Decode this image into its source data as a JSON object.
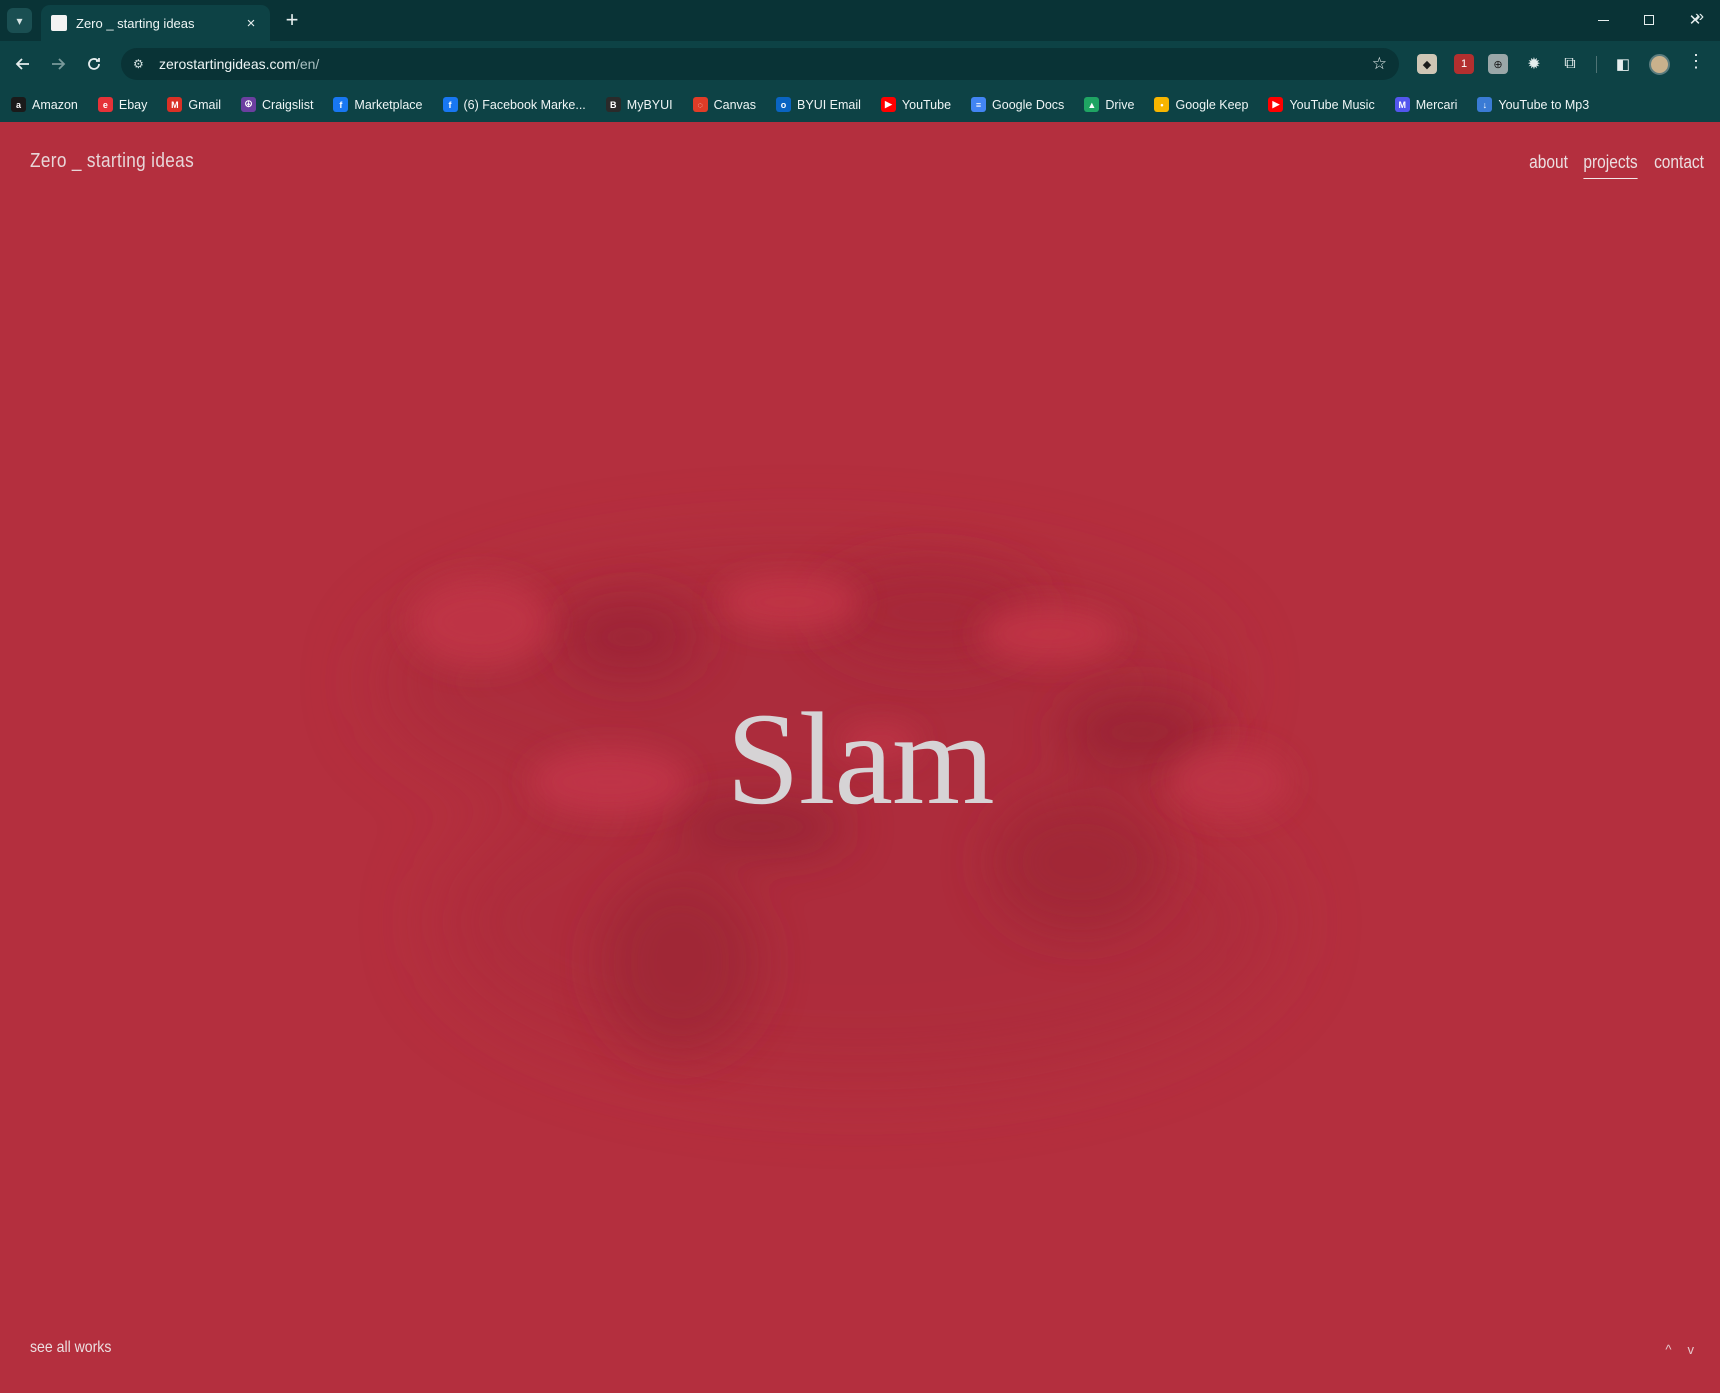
{
  "browser": {
    "tab_title": "Zero _ starting ideas",
    "tab_close": "×",
    "new_tab": "+",
    "url_host": "zerostartingideas.com",
    "url_path": "/en/",
    "bookmarks": [
      {
        "label": "Amazon",
        "icon": "amazon-icon",
        "color": "#1a1a1a",
        "glyph": "a"
      },
      {
        "label": "Ebay",
        "icon": "ebay-icon",
        "color": "#e53238",
        "glyph": "e"
      },
      {
        "label": "Gmail",
        "icon": "gmail-icon",
        "color": "#d93025",
        "glyph": "M"
      },
      {
        "label": "Craigslist",
        "icon": "craigslist-icon",
        "color": "#6b3fa0",
        "glyph": "☮"
      },
      {
        "label": "Marketplace",
        "icon": "facebook-icon",
        "color": "#1877f2",
        "glyph": "f"
      },
      {
        "label": "(6) Facebook Marke...",
        "icon": "facebook-icon",
        "color": "#1877f2",
        "glyph": "f"
      },
      {
        "label": "MyBYUI",
        "icon": "byui-icon",
        "color": "#2a2a2a",
        "glyph": "B"
      },
      {
        "label": "Canvas",
        "icon": "canvas-icon",
        "color": "#e13c27",
        "glyph": "◌"
      },
      {
        "label": "BYUI Email",
        "icon": "outlook-icon",
        "color": "#0a64c2",
        "glyph": "o"
      },
      {
        "label": "YouTube",
        "icon": "youtube-icon",
        "color": "#ff0000",
        "glyph": "▶"
      },
      {
        "label": "Google Docs",
        "icon": "docs-icon",
        "color": "#4285f4",
        "glyph": "≡"
      },
      {
        "label": "Drive",
        "icon": "drive-icon",
        "color": "#1fa463",
        "glyph": "▲"
      },
      {
        "label": "Google Keep",
        "icon": "keep-icon",
        "color": "#f7b500",
        "glyph": "•"
      },
      {
        "label": "YouTube Music",
        "icon": "youtube-music-icon",
        "color": "#ff0000",
        "glyph": "▶"
      },
      {
        "label": "Mercari",
        "icon": "mercari-icon",
        "color": "#5356ee",
        "glyph": "M"
      },
      {
        "label": "YouTube to Mp3",
        "icon": "download-icon",
        "color": "#3a7bd5",
        "glyph": "↓"
      }
    ],
    "bookmarks_more": "»",
    "extension_badge": "1"
  },
  "page": {
    "brand": "Zero _ starting ideas",
    "nav": [
      {
        "label": "about",
        "active": false
      },
      {
        "label": "projects",
        "active": true
      },
      {
        "label": "contact",
        "active": false
      }
    ],
    "hero_title": "Slam",
    "see_all": "see all works",
    "pager_up": "^",
    "pager_down": "v",
    "colors": {
      "background": "#b42f3e",
      "title": "#d6d3d5"
    }
  }
}
